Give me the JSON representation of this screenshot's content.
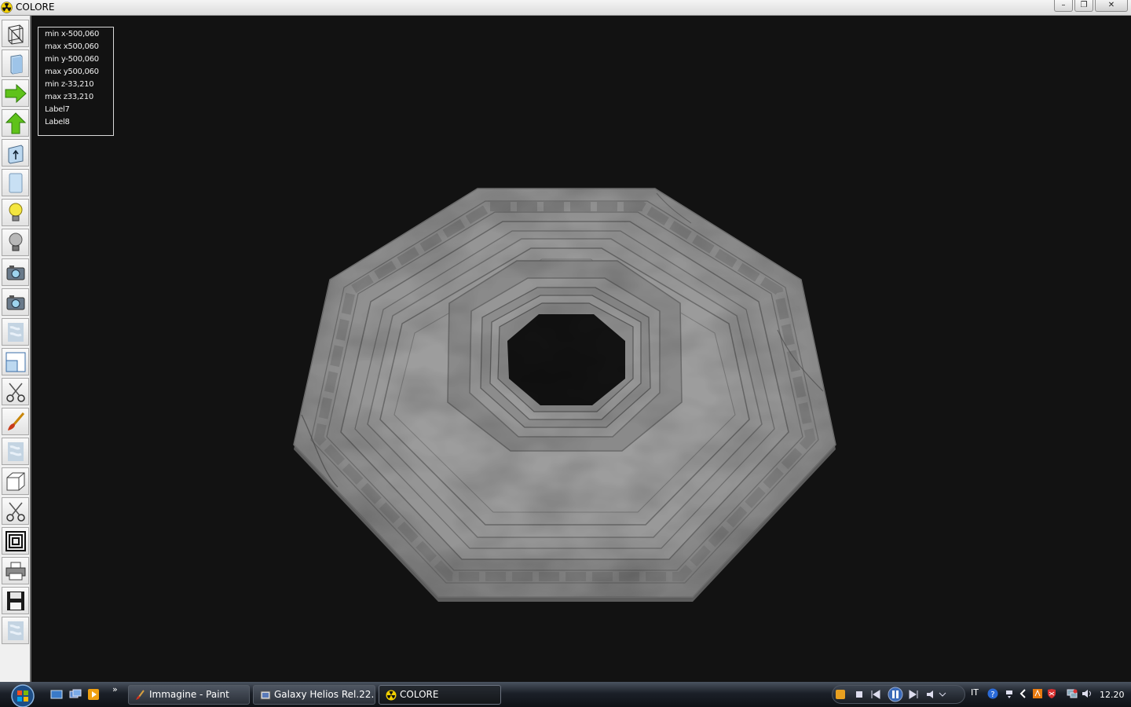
{
  "window": {
    "title": "COLORE",
    "controls": {
      "minimize": "–",
      "maximize": "❐",
      "close": "✕"
    }
  },
  "toolbar": {
    "tools": [
      {
        "name": "wireframe-box-tool",
        "icon": "wireframe-box-icon"
      },
      {
        "name": "solid-box-tool",
        "icon": "solid-box-icon"
      },
      {
        "name": "arrow-right-tool",
        "icon": "green-arrow-right-icon"
      },
      {
        "name": "arrow-up-tool",
        "icon": "green-arrow-up-icon"
      },
      {
        "name": "move-up-tool",
        "icon": "box-up-arrow-icon"
      },
      {
        "name": "panel-tool",
        "icon": "panel-icon"
      },
      {
        "name": "light-on-tool",
        "icon": "lightbulb-yellow-icon"
      },
      {
        "name": "light-off-tool",
        "icon": "lightbulb-gray-icon"
      },
      {
        "name": "camera-tool",
        "icon": "camera-icon"
      },
      {
        "name": "camera-2-tool",
        "icon": "camera-icon"
      },
      {
        "name": "texture-tool",
        "icon": "texture-icon"
      },
      {
        "name": "window-tool",
        "icon": "window-icon"
      },
      {
        "name": "cut-tool",
        "icon": "scissors-icon"
      },
      {
        "name": "paint-tool",
        "icon": "paintbrush-icon"
      },
      {
        "name": "texture-2-tool",
        "icon": "texture-icon"
      },
      {
        "name": "cube-tool",
        "icon": "cube-icon"
      },
      {
        "name": "cut-2-tool",
        "icon": "scissors-icon"
      },
      {
        "name": "frame-tool",
        "icon": "concentric-squares-icon"
      },
      {
        "name": "print-tool",
        "icon": "printer-icon"
      },
      {
        "name": "save-tool",
        "icon": "floppy-disk-icon"
      },
      {
        "name": "texture-3-tool",
        "icon": "texture-icon"
      }
    ]
  },
  "info": {
    "min_x": "min x-500,060",
    "max_x": "max x500,060",
    "min_y": "min y-500,060",
    "max_y": "max y500,060",
    "min_z": "min z-33,210",
    "max_z": "max z33,210",
    "label7": "Label7",
    "label8": "Label8"
  },
  "taskbar": {
    "more": "»",
    "tasks": [
      {
        "label": "Immagine - Paint",
        "icon": "paint-icon"
      },
      {
        "label": "Galaxy Helios  Rel.22...",
        "icon": "galaxy-icon"
      },
      {
        "label": "COLORE",
        "icon": "colore-icon"
      }
    ],
    "language": "IT",
    "clock": "12.20"
  },
  "colors": {
    "viewport_bg": "#121212",
    "marble": "#8e8e8e",
    "toolbar_bg": "#f0f0f0",
    "taskbar_bg": "#1b2028"
  }
}
